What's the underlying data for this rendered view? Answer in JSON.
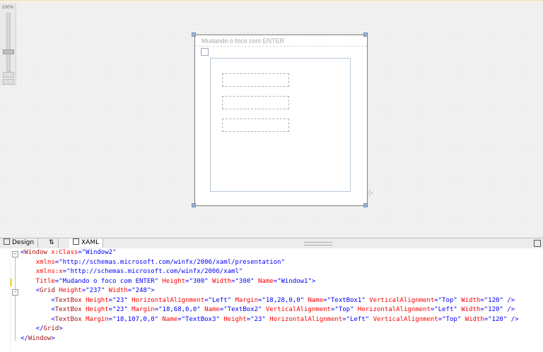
{
  "zoom": {
    "level": "100%"
  },
  "designer": {
    "window_title": "Mudando o foco com ENTER"
  },
  "tabs": {
    "design": "Design",
    "swap": "⇅",
    "xaml": "XAML"
  },
  "xaml": {
    "lines": [
      [
        [
          "p",
          "<"
        ],
        [
          "t",
          "Window"
        ],
        [
          "a",
          " x:Class"
        ],
        [
          "p",
          "="
        ],
        [
          "v",
          "\"Window2\""
        ]
      ],
      [
        [
          "a",
          "    xmlns"
        ],
        [
          "p",
          "="
        ],
        [
          "v",
          "\"http://schemas.microsoft.com/winfx/2006/xaml/presentation\""
        ]
      ],
      [
        [
          "a",
          "    xmlns:x"
        ],
        [
          "p",
          "="
        ],
        [
          "v",
          "\"http://schemas.microsoft.com/winfx/2006/xaml\""
        ]
      ],
      [
        [
          "a",
          "    Title"
        ],
        [
          "p",
          "="
        ],
        [
          "v",
          "\"Mudando o foco com ENTER\""
        ],
        [
          "a",
          " Height"
        ],
        [
          "p",
          "="
        ],
        [
          "v",
          "\"300\""
        ],
        [
          "a",
          " Width"
        ],
        [
          "p",
          "="
        ],
        [
          "v",
          "\"300\""
        ],
        [
          "a",
          " Name"
        ],
        [
          "p",
          "="
        ],
        [
          "v",
          "\"Window1\""
        ],
        [
          "p",
          ">"
        ]
      ],
      [
        [
          "p",
          "    <"
        ],
        [
          "t",
          "Grid"
        ],
        [
          "a",
          " Height"
        ],
        [
          "p",
          "="
        ],
        [
          "v",
          "\"237\""
        ],
        [
          "a",
          " Width"
        ],
        [
          "p",
          "="
        ],
        [
          "v",
          "\"248\""
        ],
        [
          "p",
          ">"
        ]
      ],
      [
        [
          "p",
          "        <"
        ],
        [
          "t",
          "TextBox"
        ],
        [
          "a",
          " Height"
        ],
        [
          "p",
          "="
        ],
        [
          "v",
          "\"23\""
        ],
        [
          "a",
          " HorizontalAlignment"
        ],
        [
          "p",
          "="
        ],
        [
          "v",
          "\"Left\""
        ],
        [
          "a",
          " Margin"
        ],
        [
          "p",
          "="
        ],
        [
          "v",
          "\"18,28,0,0\""
        ],
        [
          "a",
          " Name"
        ],
        [
          "p",
          "="
        ],
        [
          "v",
          "\"TextBox1\""
        ],
        [
          "a",
          " VerticalAlignment"
        ],
        [
          "p",
          "="
        ],
        [
          "v",
          "\"Top\""
        ],
        [
          "a",
          " Width"
        ],
        [
          "p",
          "="
        ],
        [
          "v",
          "\"120\""
        ],
        [
          "p",
          " />"
        ]
      ],
      [
        [
          "p",
          "        <"
        ],
        [
          "t",
          "TextBox"
        ],
        [
          "a",
          " Height"
        ],
        [
          "p",
          "="
        ],
        [
          "v",
          "\"23\""
        ],
        [
          "a",
          " Margin"
        ],
        [
          "p",
          "="
        ],
        [
          "v",
          "\"18,68,0,0\""
        ],
        [
          "a",
          " Name"
        ],
        [
          "p",
          "="
        ],
        [
          "v",
          "\"TextBox2\""
        ],
        [
          "a",
          " VerticalAlignment"
        ],
        [
          "p",
          "="
        ],
        [
          "v",
          "\"Top\""
        ],
        [
          "a",
          " HorizontalAlignment"
        ],
        [
          "p",
          "="
        ],
        [
          "v",
          "\"Left\""
        ],
        [
          "a",
          " Width"
        ],
        [
          "p",
          "="
        ],
        [
          "v",
          "\"120\""
        ],
        [
          "p",
          " />"
        ]
      ],
      [
        [
          "p",
          "        <"
        ],
        [
          "t",
          "TextBox"
        ],
        [
          "a",
          " Margin"
        ],
        [
          "p",
          "="
        ],
        [
          "v",
          "\"18,107,0,0\""
        ],
        [
          "a",
          " Name"
        ],
        [
          "p",
          "="
        ],
        [
          "v",
          "\"TextBox3\""
        ],
        [
          "a",
          " Height"
        ],
        [
          "p",
          "="
        ],
        [
          "v",
          "\"23\""
        ],
        [
          "a",
          " HorizontalAlignment"
        ],
        [
          "p",
          "="
        ],
        [
          "v",
          "\"Left\""
        ],
        [
          "a",
          " VerticalAlignment"
        ],
        [
          "p",
          "="
        ],
        [
          "v",
          "\"Top\""
        ],
        [
          "a",
          " Width"
        ],
        [
          "p",
          "="
        ],
        [
          "v",
          "\"120\""
        ],
        [
          "p",
          " />"
        ]
      ],
      [
        [
          "p",
          "    </"
        ],
        [
          "t",
          "Grid"
        ],
        [
          "p",
          ">"
        ]
      ],
      [
        [
          "p",
          "</"
        ],
        [
          "t",
          "Window"
        ],
        [
          "p",
          ">"
        ]
      ]
    ]
  }
}
